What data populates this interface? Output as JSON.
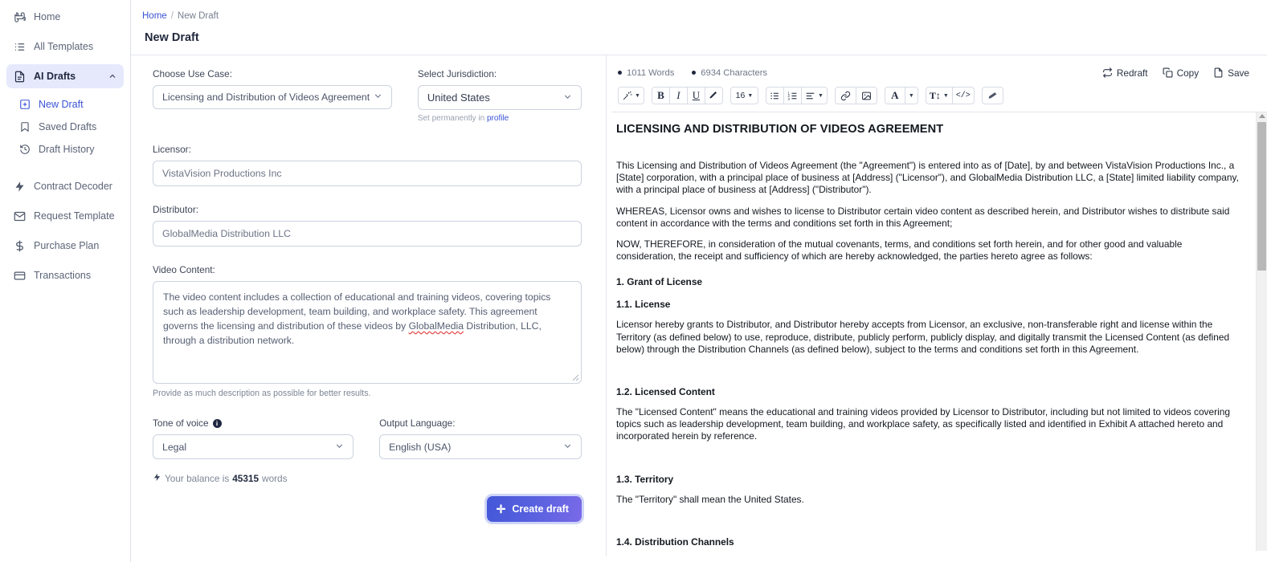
{
  "sidebar": {
    "items": [
      {
        "label": "Home",
        "icon": "command-icon"
      },
      {
        "label": "All Templates",
        "icon": "list-icon"
      },
      {
        "label": "AI Drafts",
        "icon": "document-icon",
        "chevron": "chevron-up-icon"
      }
    ],
    "sub_items": [
      {
        "label": "New Draft",
        "icon": "plus-square-icon"
      },
      {
        "label": "Saved Drafts",
        "icon": "bookmark-icon"
      },
      {
        "label": "Draft History",
        "icon": "history-icon"
      }
    ],
    "lower_items": [
      {
        "label": "Contract Decoder",
        "icon": "bolt-icon"
      },
      {
        "label": "Request Template",
        "icon": "envelope-icon"
      },
      {
        "label": "Purchase Plan",
        "icon": "dollar-icon"
      },
      {
        "label": "Transactions",
        "icon": "card-icon"
      }
    ]
  },
  "breadcrumb": {
    "home": "Home",
    "separator": "/",
    "current": "New Draft"
  },
  "page_title": "New Draft",
  "form": {
    "use_case_label": "Choose Use Case:",
    "use_case_value": "Licensing and Distribution of Videos Agreement",
    "jurisdiction_label": "Select Jurisdiction:",
    "jurisdiction_value": "United States",
    "jurisdiction_hint_prefix": "Set permanently in ",
    "jurisdiction_hint_link": "profile",
    "licensor_label": "Licensor:",
    "licensor_value": "VistaVision Productions Inc",
    "distributor_label": "Distributor:",
    "distributor_value": "GlobalMedia Distribution LLC",
    "video_content_label": "Video Content:",
    "video_content_part1": "The video content includes a collection of educational and training videos, covering topics such as leadership development, team building, and workplace safety. This agreement governs the licensing and distribution of these videos by ",
    "video_content_misspelled": "GlobalMedia",
    "video_content_part2": " Distribution, LLC, through a distribution network.",
    "video_content_help": "Provide as much description as possible for better results.",
    "tone_label": "Tone of voice",
    "tone_value": "Legal",
    "language_label": "Output Language:",
    "language_value": "English (USA)",
    "balance_prefix": "Your balance is",
    "balance_amount": "45315",
    "balance_suffix": "words",
    "create_button": "Create draft"
  },
  "editor": {
    "word_count": "1011 Words",
    "char_count": "6934 Characters",
    "actions": [
      {
        "label": "Redraft",
        "icon": "redraft-icon"
      },
      {
        "label": "Copy",
        "icon": "copy-icon"
      },
      {
        "label": "Save",
        "icon": "save-icon"
      }
    ],
    "toolbar": {
      "magic": "magic-wand-icon",
      "bold": "B",
      "italic": "I",
      "underline": "U",
      "highlight": "highlight-icon",
      "font_size": "16",
      "bullet_list": "bullet-list-icon",
      "numbered_list": "numbered-list-icon",
      "align": "align-left-icon",
      "link": "link-icon",
      "image": "image-icon",
      "font_color": "A",
      "line_height": "line-height-icon",
      "code": "</>",
      "clear_format": "eraser-icon"
    }
  },
  "document": {
    "title": "LICENSING AND DISTRIBUTION OF VIDEOS AGREEMENT",
    "p1": "This Licensing and Distribution of Videos Agreement (the \"Agreement\") is entered into as of [Date], by and between VistaVision Productions Inc., a [State] corporation, with a principal place of business at [Address] (\"Licensor\"), and GlobalMedia Distribution LLC, a [State] limited liability company, with a principal place of business at [Address] (\"Distributor\").",
    "p2": "WHEREAS, Licensor owns and wishes to license to Distributor certain video content as described herein, and Distributor wishes to distribute said content in accordance with the terms and conditions set forth in this Agreement;",
    "p3": "NOW, THEREFORE, in consideration of the mutual covenants, terms, and conditions set forth herein, and for other good and valuable consideration, the receipt and sufficiency of which are hereby acknowledged, the parties hereto agree as follows:",
    "h1_section": "1. Grant of License",
    "h11": "1.1. License",
    "p11": "Licensor hereby grants to Distributor, and Distributor hereby accepts from Licensor, an exclusive, non-transferable right and license within the Territory (as defined below) to use, reproduce, distribute, publicly perform, publicly display, and digitally transmit the Licensed Content (as defined below) through the Distribution Channels (as defined below), subject to the terms and conditions set forth in this Agreement.",
    "h12": "1.2. Licensed Content",
    "p12": "The \"Licensed Content\" means the educational and training videos provided by Licensor to Distributor, including but not limited to videos covering topics such as leadership development, team building, and workplace safety, as specifically listed and identified in Exhibit A attached hereto and incorporated herein by reference.",
    "h13": "1.3. Territory",
    "p13": "The \"Territory\" shall mean the United States.",
    "h14": "1.4. Distribution Channels"
  },
  "colors": {
    "accent": "#3b53d6",
    "sidebar_active_bg": "#e6e9fc",
    "button_gradient_start": "#4458d8",
    "button_gradient_end": "#7a6ae8"
  }
}
